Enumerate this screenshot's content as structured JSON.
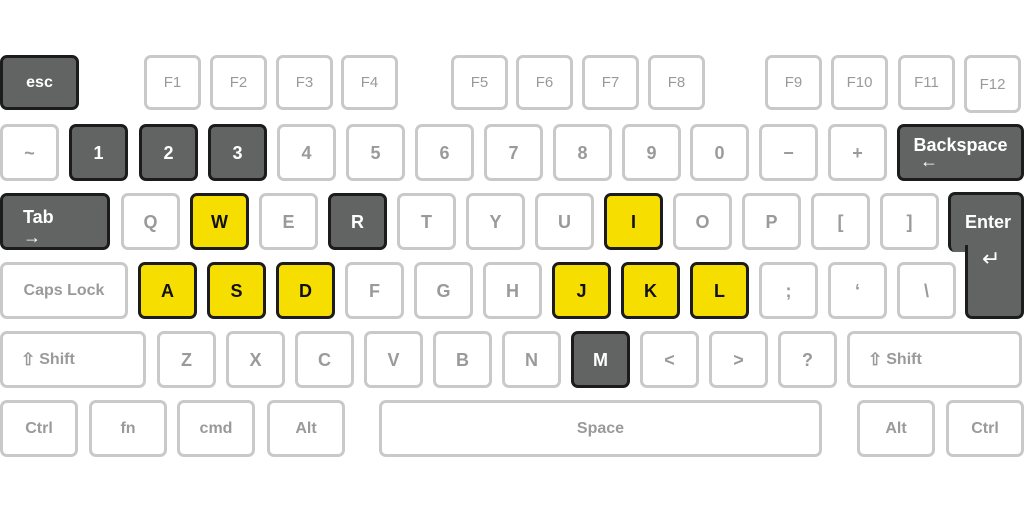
{
  "keyboard": {
    "row_function": {
      "esc": "esc",
      "f1": "F1",
      "f2": "F2",
      "f3": "F3",
      "f4": "F4",
      "f5": "F5",
      "f6": "F6",
      "f7": "F7",
      "f8": "F8",
      "f9": "F9",
      "f10": "F10",
      "f11": "F11",
      "f12": "F12"
    },
    "row_number": {
      "tilde": "~",
      "k1": "1",
      "k2": "2",
      "k3": "3",
      "k4": "4",
      "k5": "5",
      "k6": "6",
      "k7": "7",
      "k8": "8",
      "k9": "9",
      "k0": "0",
      "minus": "−",
      "plus": "+",
      "backspace": "Backspace",
      "backspace_arrow": "←"
    },
    "row_top": {
      "tab": "Tab",
      "tab_arrow": "→",
      "q": "Q",
      "w": "W",
      "e": "E",
      "r": "R",
      "t": "T",
      "y": "Y",
      "u": "U",
      "i": "I",
      "o": "O",
      "p": "P",
      "lbracket": "[",
      "rbracket": "]",
      "enter": "Enter",
      "enter_arrow": "↵"
    },
    "row_home": {
      "caps": "Caps Lock",
      "a": "A",
      "s": "S",
      "d": "D",
      "f": "F",
      "g": "G",
      "h": "H",
      "j": "J",
      "k": "K",
      "l": "L",
      "semicolon": ";",
      "quote": "‘",
      "backslash": "\\"
    },
    "row_bottom": {
      "shift_glyph": "⇧",
      "shift": "Shift",
      "z": "Z",
      "x": "X",
      "c": "C",
      "v": "V",
      "b": "B",
      "n": "N",
      "m": "M",
      "lt": "<",
      "gt": ">",
      "question": "?"
    },
    "row_space": {
      "ctrl": "Ctrl",
      "fn": "fn",
      "cmd": "cmd",
      "alt": "Alt",
      "space": "Space"
    }
  },
  "colors": {
    "highlight_yellow": "#f6df00",
    "highlight_gray": "#626463",
    "default_key": "#ffffff",
    "default_border": "#c9c9c9"
  }
}
